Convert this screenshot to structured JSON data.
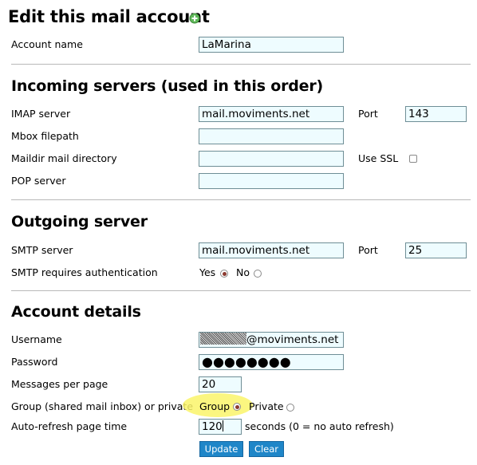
{
  "title": "Edit this mail account",
  "account_name": {
    "label": "Account name",
    "value": "LaMarina"
  },
  "incoming": {
    "heading": "Incoming servers (used in this order)",
    "imap_label": "IMAP server",
    "imap_value": "mail.moviments.net",
    "port_label": "Port",
    "port_value": "143",
    "mbox_label": "Mbox filepath",
    "mbox_value": "",
    "maildir_label": "Maildir mail directory",
    "maildir_value": "",
    "ssl_label": "Use SSL",
    "ssl_checked": false,
    "pop_label": "POP server",
    "pop_value": ""
  },
  "outgoing": {
    "heading": "Outgoing server",
    "smtp_label": "SMTP server",
    "smtp_value": "mail.moviments.net",
    "port_label": "Port",
    "port_value": "25",
    "auth_label": "SMTP requires authentication",
    "yes_label": "Yes",
    "no_label": "No",
    "auth_selected": "Yes"
  },
  "details": {
    "heading": "Account details",
    "username_label": "Username",
    "username_suffix": "@moviments.net",
    "password_label": "Password",
    "password_mask": "●●●●●●●●",
    "messages_label": "Messages per page",
    "messages_value": "20",
    "group_label": "Group (shared mail inbox) or private",
    "group_option": "Group",
    "private_option": "Private",
    "group_selected": "Group",
    "refresh_label": "Auto-refresh page time",
    "refresh_value": "120",
    "refresh_hint": "seconds (0 = no auto refresh)"
  },
  "buttons": {
    "update": "Update",
    "clear": "Clear"
  },
  "colors": {
    "input_bg": "#eefcff",
    "button_bg": "#1f86c8",
    "highlight": "#faf56a",
    "add_icon": "#4caf50"
  }
}
